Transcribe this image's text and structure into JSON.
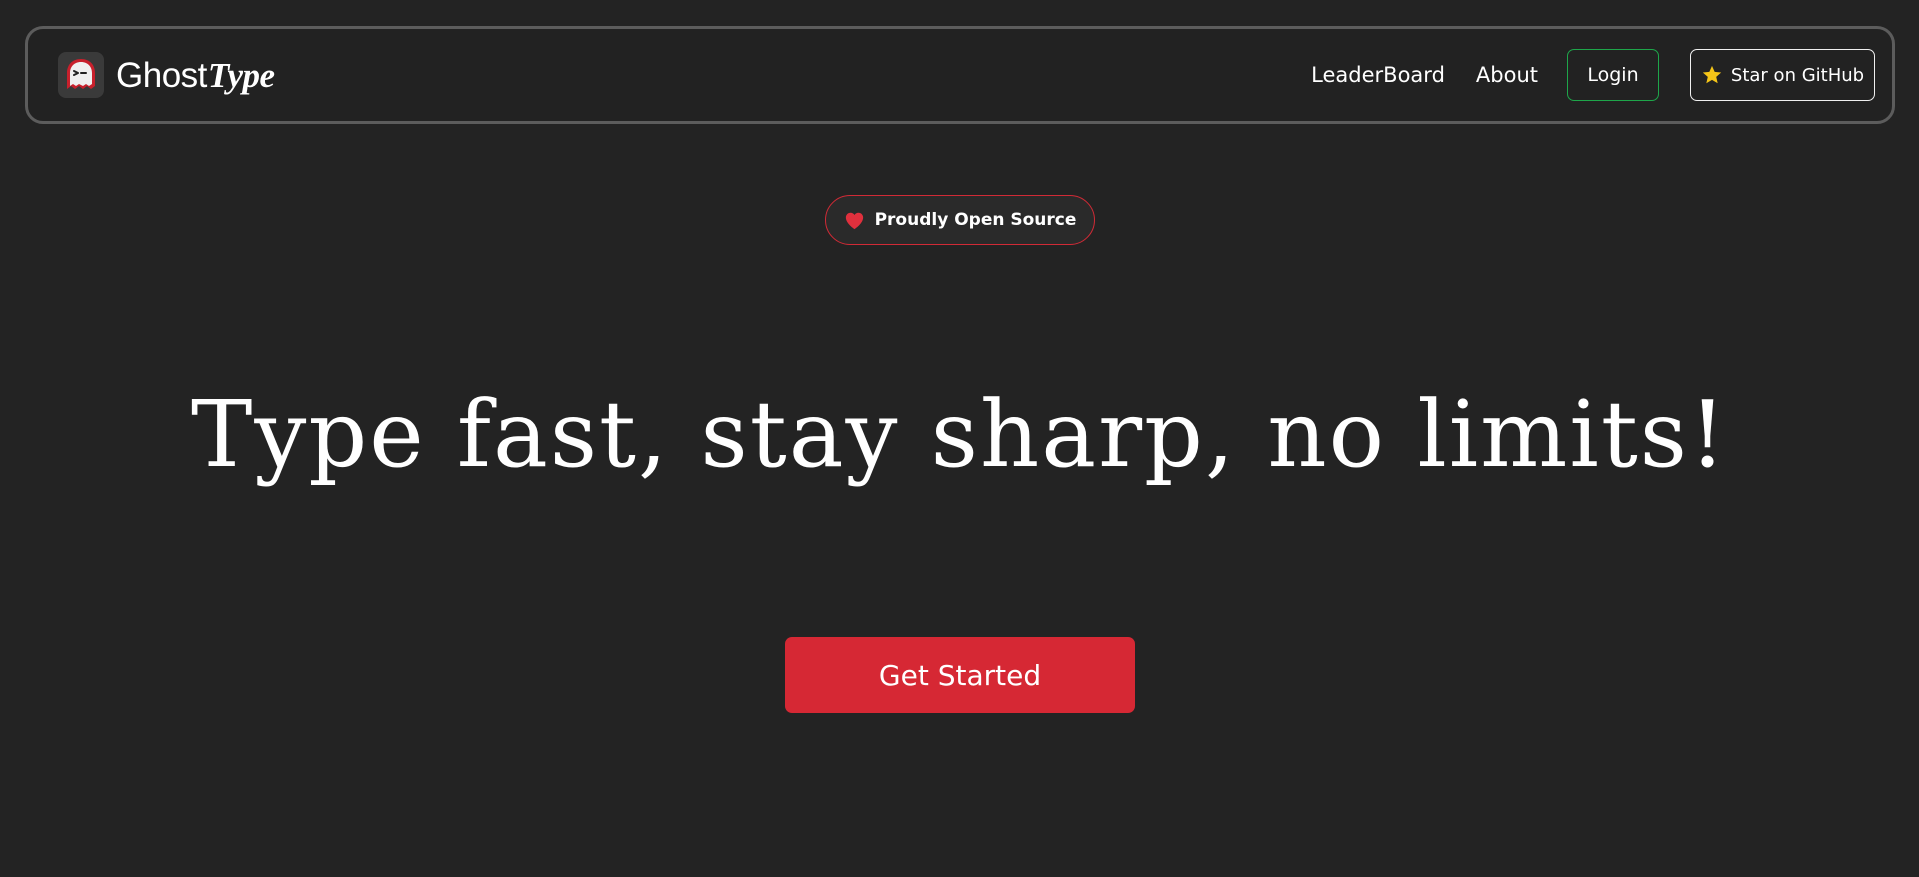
{
  "brand": {
    "name_part1": "Ghost",
    "name_part2": "Type",
    "logo_icon": "ghost-icon"
  },
  "nav": {
    "leaderboard_label": "LeaderBoard",
    "about_label": "About",
    "login_label": "Login",
    "github_label": "Star on GitHub",
    "github_icon": "star-icon"
  },
  "hero": {
    "badge_label": "Proudly Open Source",
    "badge_icon": "heart-icon",
    "headline": "Type fast, stay sharp, no limits!",
    "cta_label": "Get Started"
  },
  "colors": {
    "background": "#232323",
    "accent_red": "#d62834",
    "login_border": "#1ea64a",
    "star": "#f5c518"
  }
}
